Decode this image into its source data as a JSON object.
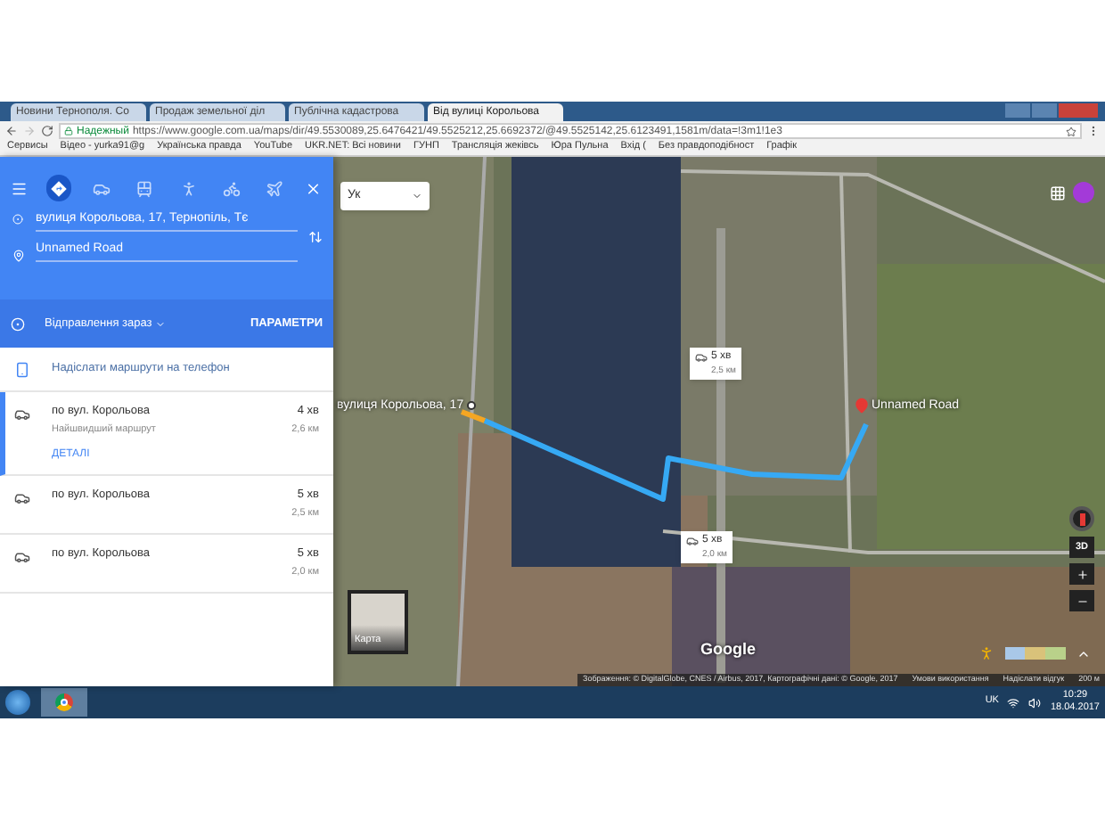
{
  "browser": {
    "tabs": [
      {
        "title": "Новини Тернополя. Со",
        "selected": false
      },
      {
        "title": "Продаж земельної діл",
        "selected": false
      },
      {
        "title": "Публічна кадастрова",
        "selected": false
      },
      {
        "title": "Від вулиці Корольова",
        "selected": true
      }
    ],
    "address": {
      "security_label": "Надежный",
      "url": "https://www.google.com.ua/maps/dir/49.5530089,25.6476421/49.5525212,25.6692372/@49.5525142,25.6123491,1581m/data=!3m1!1e3"
    },
    "bookmarks": [
      "Сервисы",
      "Відео - yurka91@g",
      "Українська правда",
      "YouTube",
      "UKR.NET: Всі новини",
      "ГУНП",
      "Трансляція жеківсь",
      "Юра Пульна",
      "Вхід (",
      "Без правдоподібност",
      "Графік"
    ]
  },
  "directions": {
    "modes": [
      {
        "kind": "best",
        "selected": true
      },
      {
        "kind": "car",
        "selected": false
      },
      {
        "kind": "transit",
        "selected": false
      },
      {
        "kind": "walk",
        "selected": false
      },
      {
        "kind": "bike",
        "selected": false
      },
      {
        "kind": "flight",
        "selected": false
      }
    ],
    "origin": "вулиця Корольова, 17, Тернопіль, Тє",
    "destination": "Unnamed Road",
    "departure": "Відправлення зараз",
    "options": "ПАРАМЕТРИ",
    "send": "Надіслати маршрути на телефон",
    "routes": [
      {
        "via": "по вул. Корольова",
        "time": "4 хв",
        "note": "Найшвидший маршрут",
        "distance": "2,6 км",
        "details": "ДЕТАЛІ",
        "selected": true
      },
      {
        "via": "по вул. Корольова",
        "time": "5 хв",
        "distance": "2,5 км",
        "selected": false
      },
      {
        "via": "по вул. Корольова",
        "time": "5 хв",
        "distance": "2,0 км",
        "selected": false
      }
    ]
  },
  "map": {
    "search": "Ук",
    "start_label": "вулиця Корольова, 17",
    "end_label": "Unnamed Road",
    "callouts": [
      {
        "time": "5 хв",
        "distance": "2,5 км"
      },
      {
        "time": "5 хв",
        "distance": "2,0 км"
      }
    ],
    "view_3d": "3D",
    "layer_toggle": "Карта",
    "logo": "Google",
    "attribution": "Зображення: © DigitalGlobe, CNES / Airbus, 2017, Картографічні дані: © Google, 2017",
    "terms": "Умови використання",
    "feedback": "Надіслати відгук",
    "scale": "200 м"
  },
  "taskbar": {
    "language": "UK",
    "time": "10:29",
    "date": "18.04.2017"
  }
}
